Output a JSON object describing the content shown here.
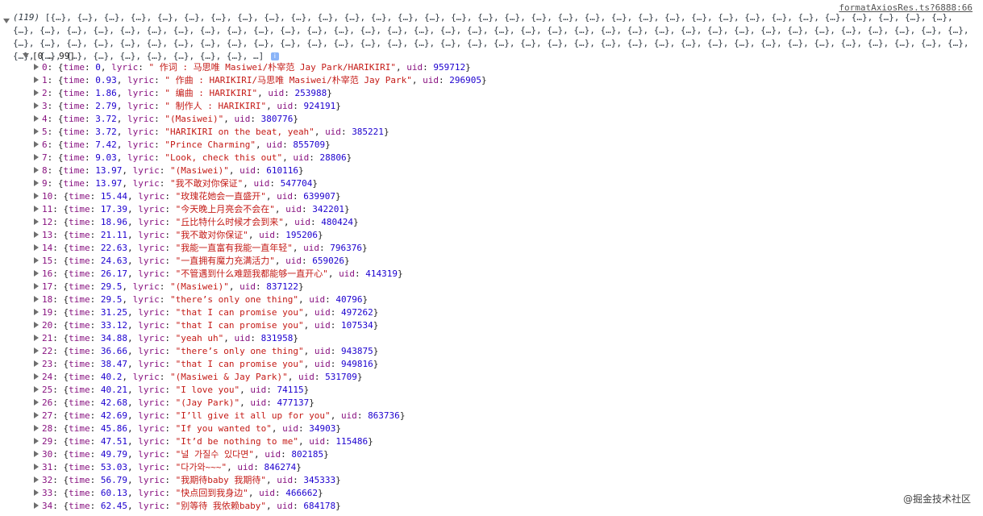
{
  "source_link": "formatAxiosRes.ts?6888:66",
  "summary": {
    "count": "(119)",
    "preview": "[{…}, {…}, {…}, {…}, {…}, {…}, {…}, {…}, {…}, {…}, {…}, {…}, {…}, {…}, {…}, {…}, {…}, {…}, {…}, {…}, {…}, {…}, {…}, {…}, {…}, {…}, {…}, {…}, {…}, {…}, {…}, {…}, {…}, {…}, {…}, {…}, {…}, {…}, {…}, {…}, {…}, {…}, {…}, {…}, {…}, {…}, {…}, {…}, {…}, {…}, {…}, {…}, {…}, {…}, {…}, {…}, {…}, {…}, {…}, {…}, {…}, {…}, {…}, {…}, {…}, {…}, {…}, {…}, {…}, {…}, {…}, {…}, {…}, {…}, {…}, {…}, {…}, {…}, {…}, {…}, {…}, {…}, {…}, {…}, {…}, {…}, {…}, {…}, {…}, {…}, {…}, {…}, {…}, {…}, {…}, {…}, {…}, {…}, {…}, {…}, {…}, {…}, {…}, {…}, {…}, {…}, {…}, {…}, {…}, {…}, {…}, {…}, {…}, {…}, {…}, …]",
    "info_icon": "i"
  },
  "range_label": "[0 … 99]",
  "rows": [
    {
      "index": "0",
      "time": "0",
      "lyric": "\" 作词 : 马思唯 Masiwei/朴宰范 Jay Park/HARIKIRI\"",
      "uid": "959712"
    },
    {
      "index": "1",
      "time": "0.93",
      "lyric": "\" 作曲 : HARIKIRI/马思唯 Masiwei/朴宰范 Jay Park\"",
      "uid": "296905"
    },
    {
      "index": "2",
      "time": "1.86",
      "lyric": "\" 编曲 : HARIKIRI\"",
      "uid": "253988"
    },
    {
      "index": "3",
      "time": "2.79",
      "lyric": "\" 制作人 : HARIKIRI\"",
      "uid": "924191"
    },
    {
      "index": "4",
      "time": "3.72",
      "lyric": "\"(Masiwei)\"",
      "uid": "380776"
    },
    {
      "index": "5",
      "time": "3.72",
      "lyric": "\"HARIKIRI on the beat, yeah\"",
      "uid": "385221"
    },
    {
      "index": "6",
      "time": "7.42",
      "lyric": "\"Prince Charming\"",
      "uid": "855709"
    },
    {
      "index": "7",
      "time": "9.03",
      "lyric": "\"Look, check this out\"",
      "uid": "28806"
    },
    {
      "index": "8",
      "time": "13.97",
      "lyric": "\"(Masiwei)\"",
      "uid": "610116"
    },
    {
      "index": "9",
      "time": "13.97",
      "lyric": "\"我不敢对你保证\"",
      "uid": "547704"
    },
    {
      "index": "10",
      "time": "15.44",
      "lyric": "\"玫瑰花她会一直盛开\"",
      "uid": "639907"
    },
    {
      "index": "11",
      "time": "17.39",
      "lyric": "\"今天晚上月亮会不会在\"",
      "uid": "342201"
    },
    {
      "index": "12",
      "time": "18.96",
      "lyric": "\"丘比特什么时候才会到来\"",
      "uid": "480424"
    },
    {
      "index": "13",
      "time": "21.11",
      "lyric": "\"我不敢对你保证\"",
      "uid": "195206"
    },
    {
      "index": "14",
      "time": "22.63",
      "lyric": "\"我能一直富有我能一直年轻\"",
      "uid": "796376"
    },
    {
      "index": "15",
      "time": "24.63",
      "lyric": "\"一直拥有魔力充满活力\"",
      "uid": "659026"
    },
    {
      "index": "16",
      "time": "26.17",
      "lyric": "\"不管遇到什么难题我都能够一直开心\"",
      "uid": "414319"
    },
    {
      "index": "17",
      "time": "29.5",
      "lyric": "\"(Masiwei)\"",
      "uid": "837122"
    },
    {
      "index": "18",
      "time": "29.5",
      "lyric": "\"there’s only one thing\"",
      "uid": "40796"
    },
    {
      "index": "19",
      "time": "31.25",
      "lyric": "\"that I can promise you\"",
      "uid": "497262"
    },
    {
      "index": "20",
      "time": "33.12",
      "lyric": "\"that I can promise you\"",
      "uid": "107534"
    },
    {
      "index": "21",
      "time": "34.88",
      "lyric": "\"yeah uh\"",
      "uid": "831958"
    },
    {
      "index": "22",
      "time": "36.66",
      "lyric": "\"there’s only one thing\"",
      "uid": "943875"
    },
    {
      "index": "23",
      "time": "38.47",
      "lyric": "\"that I can promise you\"",
      "uid": "949816"
    },
    {
      "index": "24",
      "time": "40.2",
      "lyric": "\"(Masiwei & Jay Park)\"",
      "uid": "531709"
    },
    {
      "index": "25",
      "time": "40.21",
      "lyric": "\"I love you\"",
      "uid": "74115"
    },
    {
      "index": "26",
      "time": "42.68",
      "lyric": "\"(Jay Park)\"",
      "uid": "477137"
    },
    {
      "index": "27",
      "time": "42.69",
      "lyric": "\"I’ll give it all up for you\"",
      "uid": "863736"
    },
    {
      "index": "28",
      "time": "45.86",
      "lyric": "\"If you wanted to\"",
      "uid": "34903"
    },
    {
      "index": "29",
      "time": "47.51",
      "lyric": "\"It’d be nothing to me\"",
      "uid": "115486"
    },
    {
      "index": "30",
      "time": "49.79",
      "lyric": "\"널 가질수 있다면\"",
      "uid": "802185"
    },
    {
      "index": "31",
      "time": "53.03",
      "lyric": "\"다가와~~~\"",
      "uid": "846274"
    },
    {
      "index": "32",
      "time": "56.79",
      "lyric": "\"我期待baby 我期待\"",
      "uid": "345333"
    },
    {
      "index": "33",
      "time": "60.13",
      "lyric": "\"快点回到我身边\"",
      "uid": "466662"
    },
    {
      "index": "34",
      "time": "62.45",
      "lyric": "\"别等待 我依赖baby\"",
      "uid": "684178"
    }
  ],
  "watermark": "@掘金技术社区",
  "colors": {
    "index": "#881280",
    "number": "#1c00cf",
    "string": "#c41a16",
    "arrow": "#6e6e6e"
  }
}
